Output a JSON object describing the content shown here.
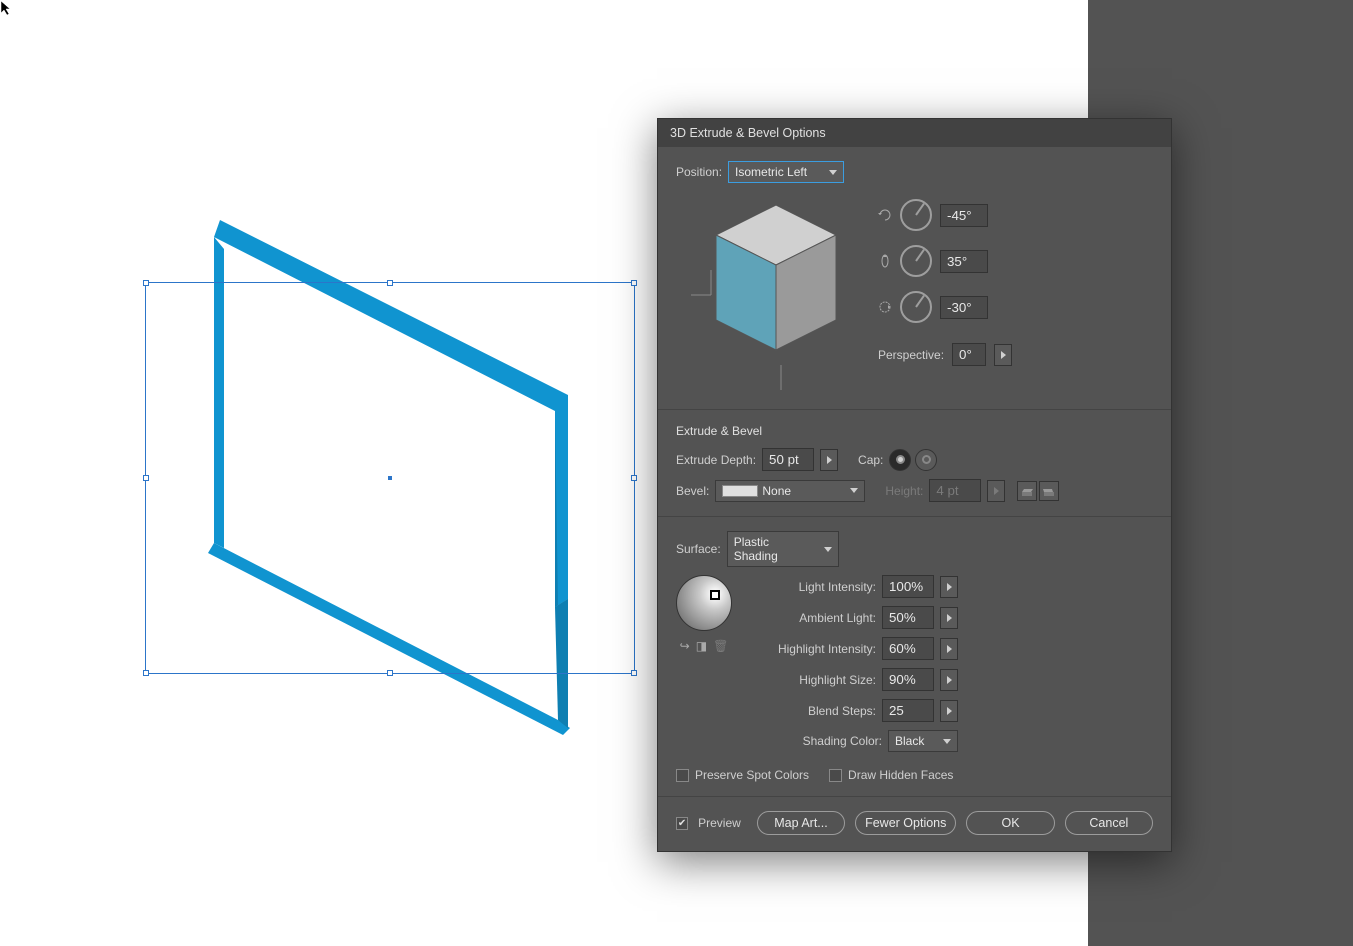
{
  "dialog": {
    "title": "3D Extrude & Bevel Options",
    "position_label": "Position:",
    "position_value": "Isometric Left",
    "rotation": {
      "x": "-45°",
      "y": "35°",
      "z": "-30°"
    },
    "perspective_label": "Perspective:",
    "perspective_value": "0°",
    "extrude_bevel": {
      "title": "Extrude & Bevel",
      "extrude_depth_label": "Extrude Depth:",
      "extrude_depth_value": "50 pt",
      "cap_label": "Cap:",
      "bevel_label": "Bevel:",
      "bevel_value": "None",
      "height_label": "Height:",
      "height_value": "4 pt"
    },
    "surface": {
      "label": "Surface:",
      "value": "Plastic Shading",
      "light_intensity_label": "Light Intensity:",
      "light_intensity_value": "100%",
      "ambient_light_label": "Ambient Light:",
      "ambient_light_value": "50%",
      "highlight_intensity_label": "Highlight Intensity:",
      "highlight_intensity_value": "60%",
      "highlight_size_label": "Highlight Size:",
      "highlight_size_value": "90%",
      "blend_steps_label": "Blend Steps:",
      "blend_steps_value": "25",
      "shading_color_label": "Shading Color:",
      "shading_color_value": "Black",
      "preserve_spot_label": "Preserve Spot Colors",
      "draw_hidden_label": "Draw Hidden Faces"
    },
    "footer": {
      "preview_label": "Preview",
      "map_art": "Map Art...",
      "fewer_options": "Fewer Options",
      "ok": "OK",
      "cancel": "Cancel"
    }
  },
  "colors": {
    "shape_stroke": "#1094D0",
    "selection": "#2C75C9"
  }
}
